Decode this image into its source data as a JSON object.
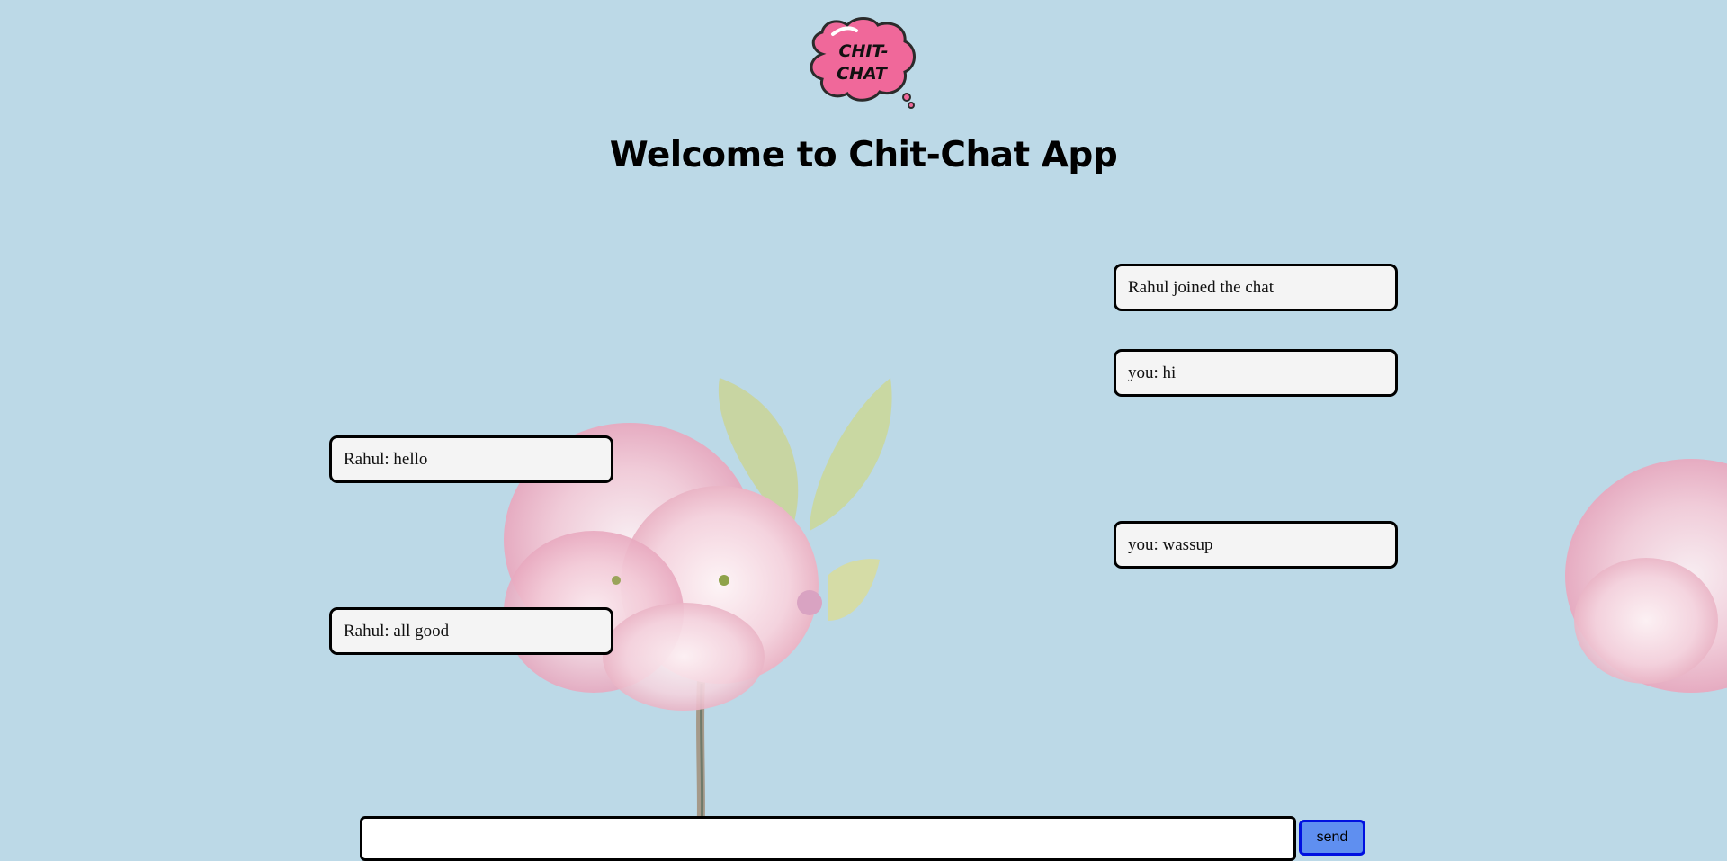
{
  "logo": {
    "line1": "CHIT-",
    "line2": "CHAT",
    "icon": "speech-bubble-logo"
  },
  "header": {
    "title": "Welcome to Chit-Chat App"
  },
  "messages": [
    {
      "side": "right",
      "text": "Rahul joined the chat"
    },
    {
      "side": "right",
      "text": "you: hi"
    },
    {
      "side": "left",
      "text": "Rahul: hello"
    },
    {
      "side": "right",
      "text": "you: wassup"
    },
    {
      "side": "left",
      "text": "Rahul: all good"
    }
  ],
  "composer": {
    "input_value": "",
    "send_label": "send"
  },
  "colors": {
    "background": "#bcd9e7",
    "logo_bubble": "#f0689a",
    "message_bg": "#f4f4f4",
    "send_button": "#5f8ff0",
    "send_border": "#0010e0"
  }
}
